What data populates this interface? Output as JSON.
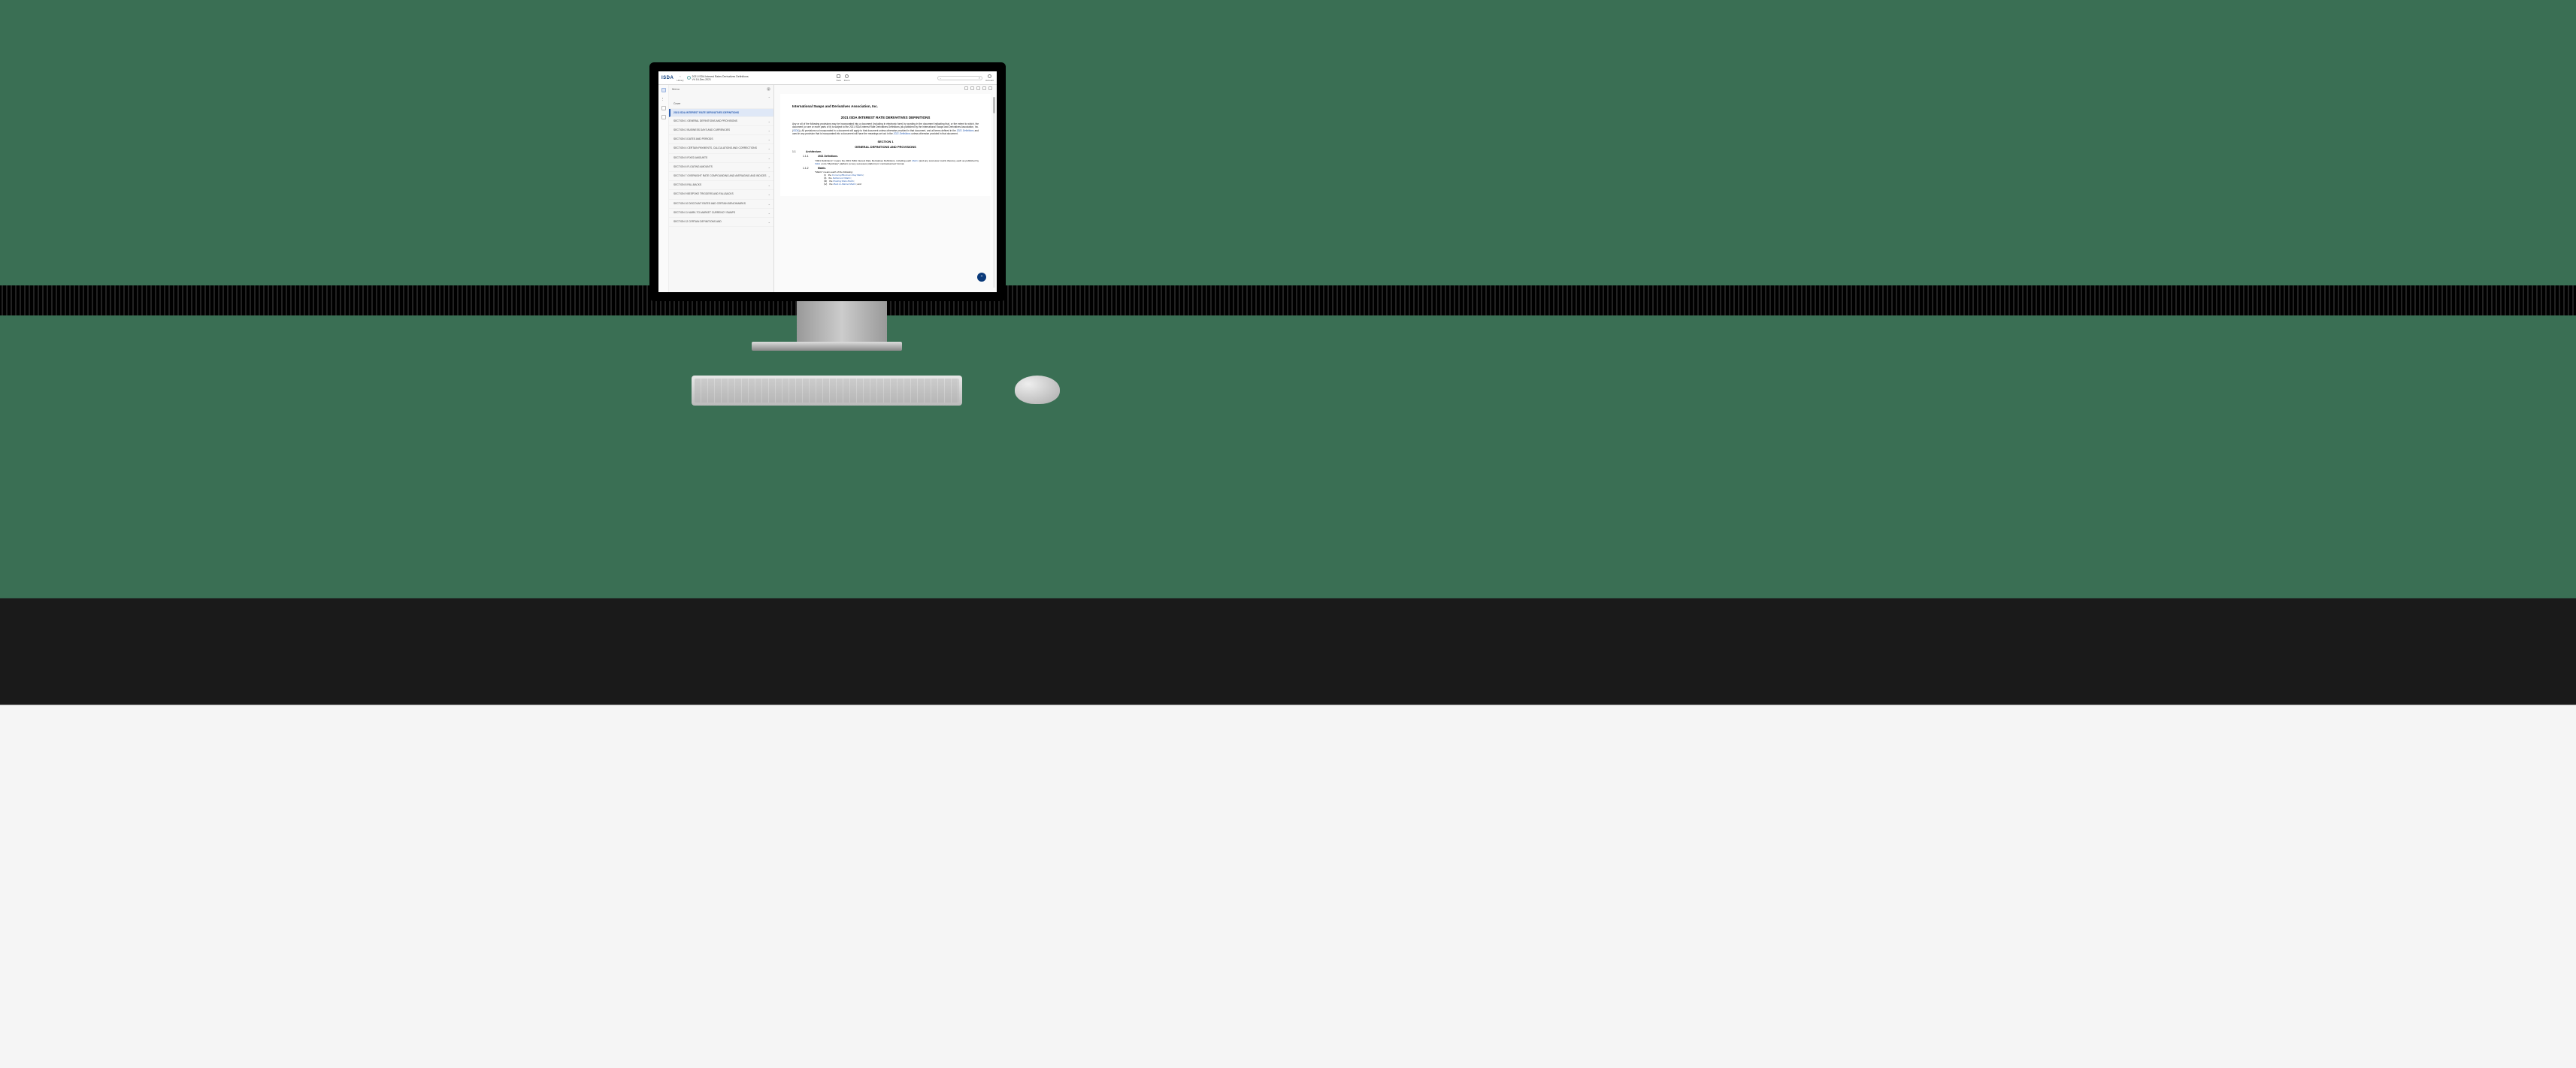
{
  "topbar": {
    "logo": "ISDA",
    "library_label": "Library",
    "view_label": "View",
    "zoom_label": "Zoom",
    "account_label": "Account",
    "doc_title_line1": "2021 ISDA Interest Rates Derivatives Definitions",
    "doc_title_line2": "V4 16-Dec-2021"
  },
  "sidebar": {
    "menu_label": "Menu",
    "cover_label": "Cover",
    "items": [
      "2021 ISDA INTEREST RATE DERIVATIVES DEFINITIONS",
      "SECTION 1 GENERAL DEFINITIONS AND PROVISIONS",
      "SECTION 2 BUSINESS DAYS AND CURRENCIES",
      "SECTION 3 DATES AND PERIODS",
      "SECTION 4 CERTAIN PAYMENTS, CALCULATIONS AND CORRECTIONS",
      "SECTION 5 FIXED AMOUNTS",
      "SECTION 6 FLOATING AMOUNTS",
      "SECTION 7 OVERNIGHT RATE COMPOUNDING AND AVERAGING AND INDICES",
      "SECTION 8 FALLBACKS",
      "SECTION 9 BESPOKE TRIGGERS AND FALLBACKS",
      "SECTION 10 DISCOUNT RATES AND CERTAIN BENCHMARKS",
      "SECTION 11 MARK-TO-MARKET CURRENCY SWAPS",
      "SECTION 12 CERTAIN DEFINITIONS AND"
    ]
  },
  "doc": {
    "association": "International Swaps and Derivatives Association, Inc.",
    "title": "2021 ISDA INTEREST RATE DERIVATIVES DEFINITIONS",
    "intro_a": "Any or all of the following provisions may be incorporated into a document (including in electronic form) by wording in the document indicating that, or the extent to which, the document (or one or more parts of it) is subject to the 2021 ISDA Interest Rate Derivatives Definitions (as published by the International Swaps and Derivatives Association, Inc. (",
    "intro_link1": "ISDA",
    "intro_b": ")). All provisions so incorporated in a document will apply to that document unless otherwise provided in that document, and all terms defined in the ",
    "intro_link2": "2021 Definitions",
    "intro_c": " and used in any provision that is incorporated into a document will have the meanings set out in the ",
    "intro_link3": "2021 Definitions",
    "intro_d": " unless otherwise provided in that document.",
    "section1": "SECTION 1",
    "section1_title": "GENERAL DEFINITIONS AND PROVISIONS",
    "h11_num": "1.1",
    "h11_txt": "Architecture.",
    "h111_num": "1.1.1",
    "h111_txt": "2021 Definitions.",
    "def2021_a": "\"2021 Definitions\" means the 2021 ISDA Interest Rate Derivatives Definitions, including each ",
    "def2021_link1": "Matrix",
    "def2021_b": " (and any successor matrix thereto), each as published by ",
    "def2021_link2": "ISDA",
    "def2021_c": " on its \"MyLibrary\" platform (or any successor platform) in 'contractual text' format.",
    "h112_num": "1.1.2",
    "h112_txt": "Matrix.",
    "matrix_intro": "\"Matrix\" means each of the following:",
    "mx": [
      {
        "n": "(i)",
        "pre": "the ",
        "link": "Currency/Business Day Matrix",
        "post": ";"
      },
      {
        "n": "(ii)",
        "pre": "the ",
        "link": "Settlement Matrix",
        "post": ";"
      },
      {
        "n": "(iii)",
        "pre": "the ",
        "link": "Floating Rate Matrix",
        "post": ";"
      },
      {
        "n": "(iv)",
        "pre": "the ",
        "link": "Mark-to-Market Matrix",
        "post": "; and"
      }
    ]
  }
}
